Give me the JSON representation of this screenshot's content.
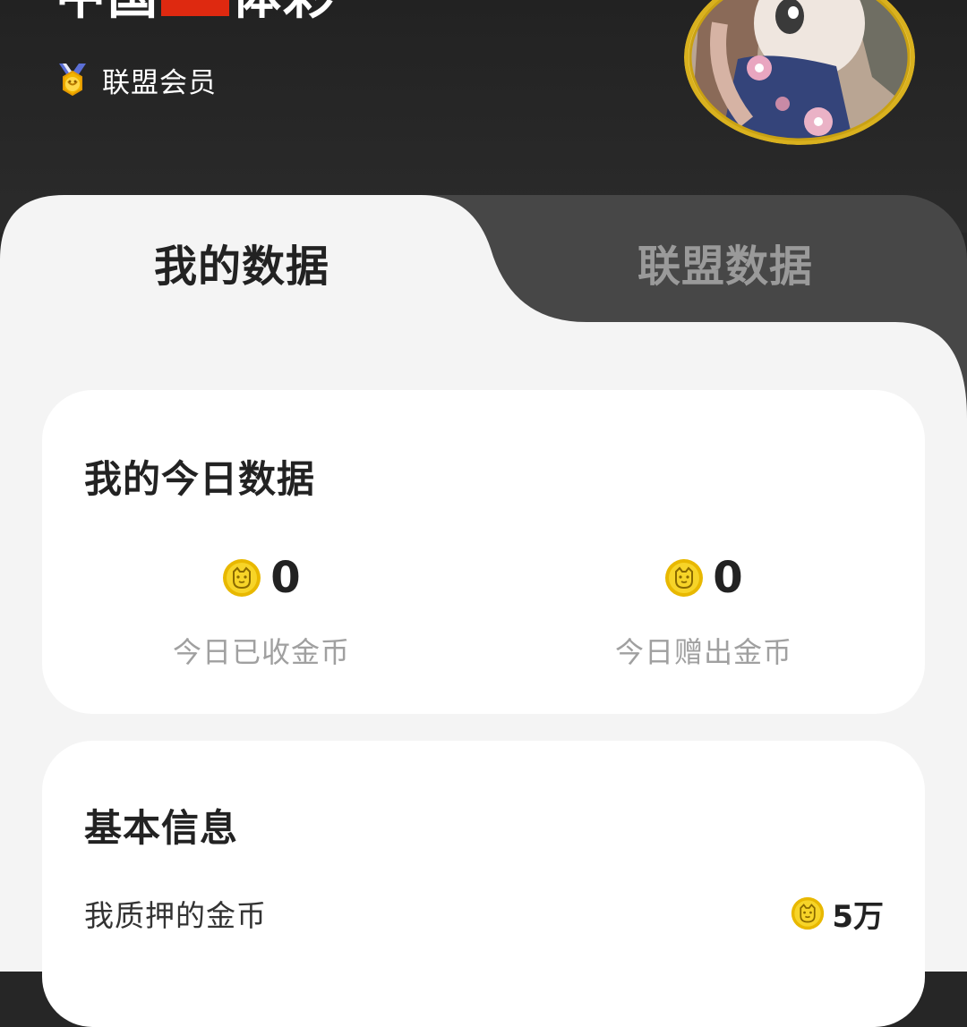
{
  "header": {
    "name_part1": "中国",
    "name_part2": "体彩",
    "flag_color": "#de2910",
    "member_label": "联盟会员",
    "member_icon": "medal-icon",
    "avatar": "anime-avatar-image"
  },
  "tabs": [
    {
      "label": "我的数据",
      "active": true
    },
    {
      "label": "联盟数据",
      "active": false
    }
  ],
  "today_card": {
    "title": "我的今日数据",
    "stats": [
      {
        "value": "0",
        "label": "今日已收金币",
        "icon": "coin-icon"
      },
      {
        "value": "0",
        "label": "今日赠出金币",
        "icon": "coin-icon"
      }
    ]
  },
  "basic_card": {
    "title": "基本信息",
    "rows": [
      {
        "label": "我质押的金币",
        "value": "5万",
        "icon": "coin-icon"
      }
    ]
  },
  "colors": {
    "background_dark": "#262626",
    "tab_inactive": "#474747",
    "sheet": "#f4f4f4",
    "card": "#ffffff",
    "coin_gold": "#f2c700",
    "avatar_ring": "#d9b11e"
  }
}
